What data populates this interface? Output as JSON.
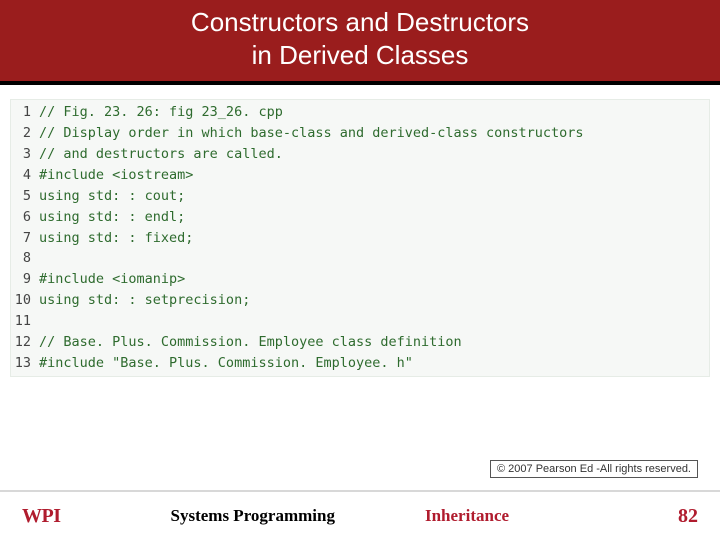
{
  "title": {
    "line1": "Constructors and Destructors",
    "line2": "in Derived Classes"
  },
  "code_lines": [
    {
      "num": "1",
      "text": "// Fig. 23. 26: fig 23_26. cpp"
    },
    {
      "num": "2",
      "text": "// Display order in which base-class and derived-class constructors"
    },
    {
      "num": "3",
      "text": "// and destructors are called."
    },
    {
      "num": "4",
      "text": "#include <iostream>"
    },
    {
      "num": "5",
      "text": "using std: : cout;"
    },
    {
      "num": "6",
      "text": "using std: : endl;"
    },
    {
      "num": "7",
      "text": "using std: : fixed;"
    },
    {
      "num": "8",
      "text": ""
    },
    {
      "num": "9",
      "text": "#include <iomanip>"
    },
    {
      "num": "10",
      "text": "using std: : setprecision;"
    },
    {
      "num": "11",
      "text": ""
    },
    {
      "num": "12",
      "text": "// Base. Plus. Commission. Employee class definition"
    },
    {
      "num": "13",
      "text": "#include \"Base. Plus. Commission. Employee. h\""
    }
  ],
  "copyright": "© 2007 Pearson Ed -All rights reserved.",
  "footer": {
    "logo": "WPI",
    "left": "Systems Programming",
    "center": "Inheritance",
    "page": "82"
  }
}
